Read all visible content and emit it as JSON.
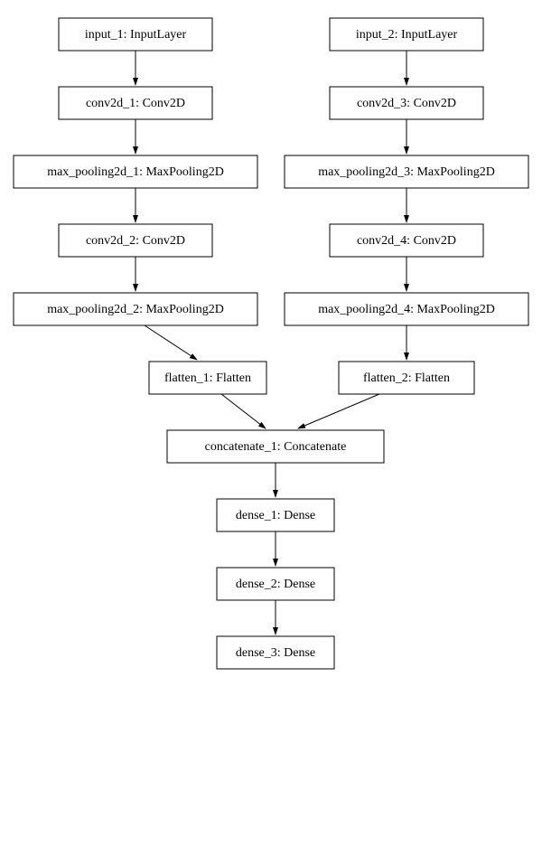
{
  "diagram": {
    "nodes": {
      "input_1": "input_1: InputLayer",
      "conv2d_1": "conv2d_1: Conv2D",
      "max_pooling2d_1": "max_pooling2d_1: MaxPooling2D",
      "conv2d_2": "conv2d_2: Conv2D",
      "max_pooling2d_2": "max_pooling2d_2: MaxPooling2D",
      "flatten_1": "flatten_1: Flatten",
      "input_2": "input_2: InputLayer",
      "conv2d_3": "conv2d_3: Conv2D",
      "max_pooling2d_3": "max_pooling2d_3: MaxPooling2D",
      "conv2d_4": "conv2d_4: Conv2D",
      "max_pooling2d_4": "max_pooling2d_4: MaxPooling2D",
      "flatten_2": "flatten_2: Flatten",
      "concatenate_1": "concatenate_1: Concatenate",
      "dense_1": "dense_1: Dense",
      "dense_2": "dense_2: Dense",
      "dense_3": "dense_3: Dense"
    }
  }
}
